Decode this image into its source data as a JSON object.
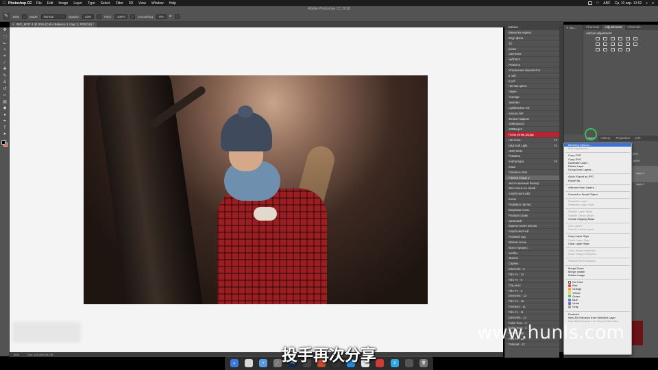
{
  "menubar": {
    "app_name": "Photoshop CC",
    "items": [
      "File",
      "Edit",
      "Image",
      "Layer",
      "Type",
      "Select",
      "Filter",
      "3D",
      "View",
      "Window",
      "Help"
    ],
    "input_lang": "ABC",
    "clock": "Ср, 10 апр. 12:52"
  },
  "options": {
    "window_title": "Adobe Photoshop CC 2018",
    "brush_size": "1500",
    "mode_label": "Mode:",
    "mode_value": "Normal",
    "opacity_label": "Opacity:",
    "opacity_value": "43%",
    "flow_label": "Flow:",
    "flow_value": "100%",
    "smoothing_label": "Smoothing:",
    "smoothing_value": "0%"
  },
  "document": {
    "tab_title": "IMG_9037-1 @ 50% (Color Balance 1 copy 3, RGB/16) *",
    "zoom": "50%",
    "doc_size": "Doc: 103,4M/216,7M"
  },
  "actions": {
    "title": "Actions",
    "items": [
      {
        "label": "Виньетка черная",
        "key": ""
      },
      {
        "label": "Блур фона",
        "key": ""
      },
      {
        "label": "3D",
        "key": ""
      },
      {
        "label": "ранко",
        "key": ""
      },
      {
        "label": "Свечение",
        "key": ""
      },
      {
        "label": "хайПасЭ",
        "key": ""
      },
      {
        "label": "Резкость",
        "key": ""
      },
      {
        "label": "Устранение пересветов",
        "key": ""
      },
      {
        "label": "в лаб",
        "key": ""
      },
      {
        "label": "в ргб",
        "key": ""
      },
      {
        "label": "Чистим цвета",
        "key": ""
      },
      {
        "label": "туман",
        "key": ""
      },
      {
        "label": "Average",
        "key": ""
      },
      {
        "label": "замочки",
        "key": ""
      },
      {
        "label": "Light/Darken SS",
        "key": ""
      },
      {
        "label": "насыщ лаб",
        "key": ""
      },
      {
        "label": "Фильм+эффект",
        "key": ""
      },
      {
        "label": "1080горизЭ",
        "key": ""
      },
      {
        "label": "1080верт2",
        "key": ""
      },
      {
        "label": "Глаза копир дордж",
        "key": ""
      },
      {
        "label": "Чистотка",
        "key": "F3"
      },
      {
        "label": "D&B Soft Light",
        "key": "F4"
      },
      {
        "label": "HDR SKIN",
        "key": ""
      },
      {
        "label": "Румянец",
        "key": ""
      },
      {
        "label": "портретура",
        "key": "F6"
      },
      {
        "label": "Кожа",
        "key": ""
      },
      {
        "label": "Childrens Skin",
        "key": ""
      },
      {
        "label": "Painted Image 2",
        "key": ""
      },
      {
        "label": "желто-зеленый блинэр",
        "key": ""
      },
      {
        "label": "Жел осень на серой",
        "key": ""
      },
      {
        "label": "голубо-желтый2",
        "key": ""
      },
      {
        "label": "осень",
        "key": ""
      },
      {
        "label": "Роз&Жел листва",
        "key": ""
      },
      {
        "label": "Багровая осень",
        "key": ""
      },
      {
        "label": "Розовая трава",
        "key": ""
      },
      {
        "label": "кремовый",
        "key": ""
      },
      {
        "label": "Красно-синяя листва",
        "key": ""
      },
      {
        "label": "голубо-желтый",
        "key": ""
      },
      {
        "label": "Розовый сад",
        "key": ""
      },
      {
        "label": "Мягкая осень",
        "key": ""
      },
      {
        "label": "Кросс-процесс",
        "key": ""
      },
      {
        "label": "шебби",
        "key": ""
      },
      {
        "label": "Зелень",
        "key": ""
      },
      {
        "label": "Сирень",
        "key": ""
      },
      {
        "label": "Elements - 5",
        "key": ""
      },
      {
        "label": "Film Fx - 13",
        "key": ""
      },
      {
        "label": "Film Fx - 9",
        "key": ""
      },
      {
        "label": "Отд нысс",
        "key": ""
      },
      {
        "label": "Film Fx - 2",
        "key": ""
      },
      {
        "label": "Elements - 13",
        "key": ""
      },
      {
        "label": "Film Fx - 15",
        "key": ""
      },
      {
        "label": "Freedom - 11",
        "key": ""
      },
      {
        "label": "Film Fx - 11",
        "key": ""
      },
      {
        "label": "Elements - 14",
        "key": ""
      },
      {
        "label": "False Tone - 3",
        "key": ""
      },
      {
        "label": "False Tone - 2",
        "key": ""
      },
      {
        "label": "Film Fx - 18",
        "key": ""
      },
      {
        "label": "Film Fx - 12",
        "key": ""
      },
      {
        "label": "Polaroid - 12",
        "key": ""
      }
    ],
    "highlight_red_index": 19,
    "highlight_grey_index": 27
  },
  "panels": {
    "mini": [
      "Bru..."
    ],
    "top_tabs": [
      "Character",
      "Adjustments",
      "Channels"
    ],
    "add_adjustment": "Add an adjustment",
    "bottom_tabs": [
      "Layers",
      "History",
      "Properties",
      "Info"
    ],
    "layer_opacity": "35%",
    "layer_fill": "100%",
    "layer_rows": [
      "copy 3",
      "copy 2"
    ]
  },
  "context_menu": {
    "items": [
      {
        "label": "Blending Options...",
        "state": "sel"
      },
      {
        "label": "Edit Adjustment...",
        "state": "dis"
      },
      {
        "sep": true
      },
      {
        "label": "Copy CSS",
        "state": ""
      },
      {
        "label": "Copy SVG",
        "state": ""
      },
      {
        "label": "Duplicate Layer...",
        "state": ""
      },
      {
        "label": "Delete Layer",
        "state": ""
      },
      {
        "label": "Group from Layers...",
        "state": ""
      },
      {
        "sep": true
      },
      {
        "label": "Quick Export as JPG",
        "state": ""
      },
      {
        "label": "Export As...",
        "state": ""
      },
      {
        "sep": true
      },
      {
        "label": "Artboard from Layers...",
        "state": ""
      },
      {
        "sep": true
      },
      {
        "label": "Convert to Smart Object",
        "state": ""
      },
      {
        "sep": true
      },
      {
        "label": "Rasterize Layer",
        "state": "dis"
      },
      {
        "label": "Rasterize Layer Style",
        "state": "dis"
      },
      {
        "sep": true
      },
      {
        "label": "Disable Layer Mask",
        "state": "dis"
      },
      {
        "label": "Disable Vector Mask",
        "state": "dis"
      },
      {
        "label": "Create Clipping Mask",
        "state": ""
      },
      {
        "sep": true
      },
      {
        "label": "Link Layers",
        "state": "dis"
      },
      {
        "label": "Select Linked Layers",
        "state": "dis"
      },
      {
        "sep": true
      },
      {
        "label": "Copy Layer Style",
        "state": ""
      },
      {
        "label": "Paste Layer Style",
        "state": "dis"
      },
      {
        "label": "Clear Layer Style",
        "state": ""
      },
      {
        "sep": true
      },
      {
        "label": "Copy Shape Attributes",
        "state": "dis"
      },
      {
        "label": "Paste Shape Attributes",
        "state": "dis"
      },
      {
        "sep": true
      },
      {
        "label": "Release from Isolation",
        "state": "dis"
      },
      {
        "sep": true
      },
      {
        "label": "Merge Down",
        "state": ""
      },
      {
        "label": "Merge Visible",
        "state": ""
      },
      {
        "label": "Flatten Image",
        "state": ""
      },
      {
        "sep": true
      },
      {
        "label": "No Color",
        "state": "",
        "color": "none"
      },
      {
        "label": "Red",
        "state": "",
        "color": "#e2453c"
      },
      {
        "label": "Orange",
        "state": "",
        "color": "#f39c33"
      },
      {
        "label": "Yellow",
        "state": "",
        "color": "#f1d33a"
      },
      {
        "label": "Green",
        "state": "",
        "color": "#5cbf4a"
      },
      {
        "label": "Blue",
        "state": "",
        "color": "#3f84de"
      },
      {
        "label": "Violet",
        "state": "",
        "color": "#9b59c9"
      },
      {
        "label": "Gray",
        "state": "",
        "color": "#9a9a9a"
      },
      {
        "sep": true
      },
      {
        "label": "Postcard",
        "state": ""
      },
      {
        "label": "New 3D Extrusion from Selected Layer",
        "state": ""
      },
      {
        "label": "New 3D Extrusion from Current Selection",
        "state": "dis"
      }
    ]
  },
  "overlay": {
    "watermark": "www.hunls.com",
    "subtitle": "投手再次分享"
  }
}
